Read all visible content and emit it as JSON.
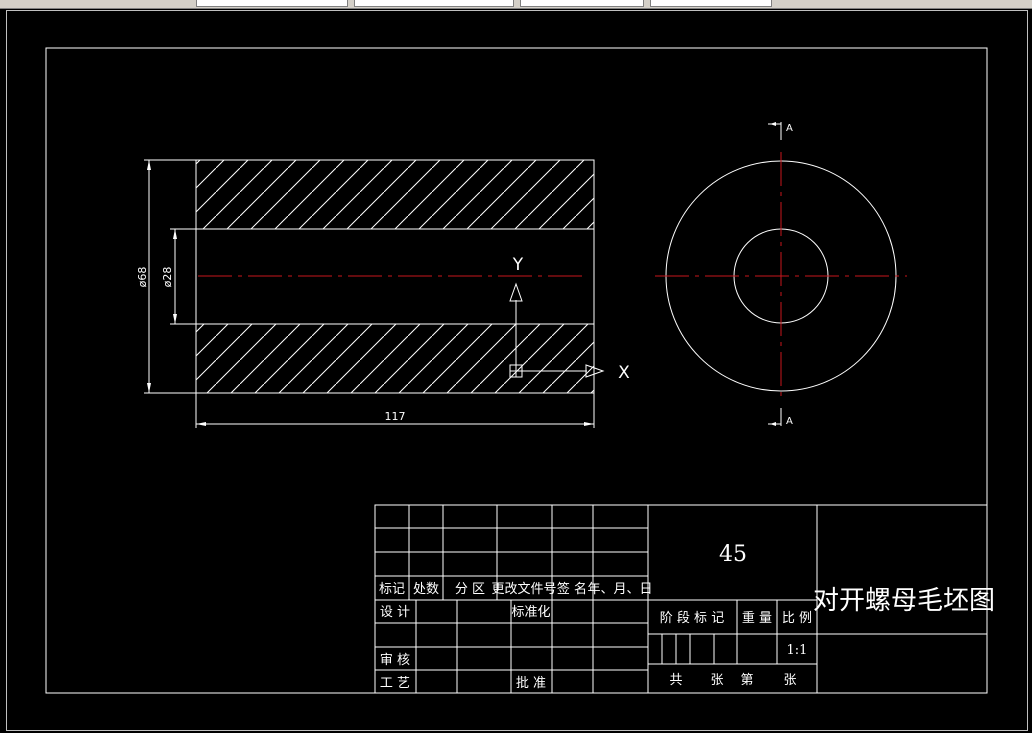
{
  "colors": {
    "background": "#000000",
    "line": "#ffffff",
    "centerline": "#c8161d"
  },
  "drawing": {
    "dim_outer": "ø68",
    "dim_inner": "ø28",
    "dim_length": "117",
    "ucs_x": "X",
    "ucs_y": "Y",
    "section_top": "A",
    "section_bottom": "A"
  },
  "title_block": {
    "material": "45",
    "title": "对开螺母毛坯图",
    "rev_headers": [
      "标记",
      "处数",
      "分 区",
      "更改文件号",
      "签 名",
      "年、月、日"
    ],
    "design": "设 计",
    "standardize": "标准化",
    "review": "审 核",
    "process": "工 艺",
    "approve": "批 准",
    "stage_mark": "阶 段 标 记",
    "weight": "重 量",
    "scale_label": "比 例",
    "scale": "1:1",
    "sheet_total": "共",
    "sheet_unit1": "张",
    "sheet_nth": "第",
    "sheet_unit2": "张"
  }
}
